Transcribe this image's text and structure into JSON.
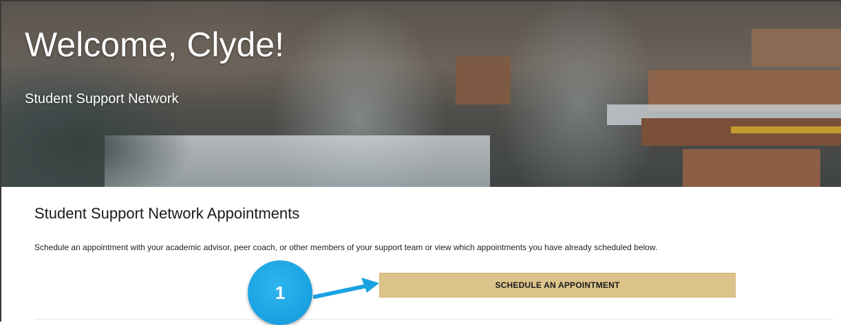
{
  "hero": {
    "title": "Welcome, Clyde!",
    "subtitle": "Student Support Network"
  },
  "appointments": {
    "heading": "Student Support Network Appointments",
    "description": "Schedule an appointment with your academic advisor, peer coach, or other members of your support team or view which appointments you have already scheduled below.",
    "schedule_button": "SCHEDULE AN APPOINTMENT"
  },
  "annotation": {
    "step_number": "1",
    "arrow_icon": "arrow-right-icon"
  },
  "colors": {
    "button_gold": "#dcc38a",
    "badge_blue": "#1aa3e2"
  }
}
